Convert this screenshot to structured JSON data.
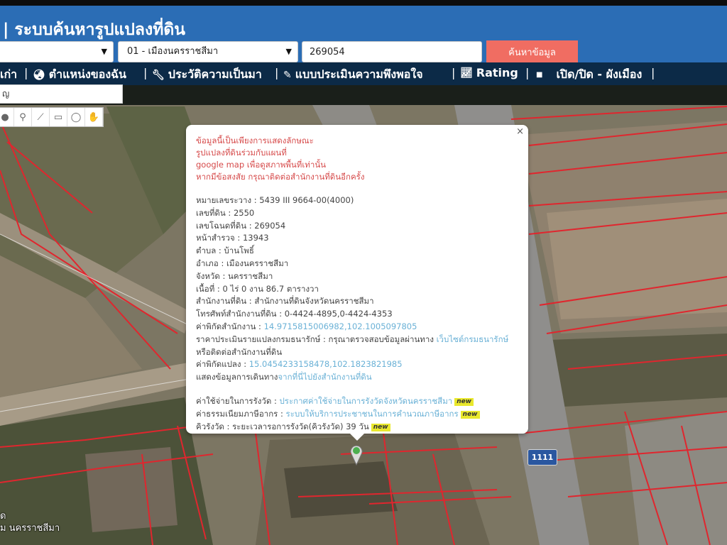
{
  "header": {
    "title": "| ระบบค้นหารูปแปลงที่ดิน",
    "province_select": "",
    "district_select": "01 - เมืองนครราชสีมา",
    "parcel_input": "269054",
    "search_button": "ค้นหาข้อมูล"
  },
  "nav": {
    "items": [
      "เก่า",
      "ตำแหน่งของฉัน",
      "ประวัติความเป็นมา",
      "แบบประเมินความพึงพอใจ",
      "Rating",
      "เปิด/ปิด - ผังเมือง"
    ],
    "separator": "|"
  },
  "map": {
    "search_box": "ญ",
    "road_sign": "1111",
    "corner_label_1": "ด",
    "corner_label_2": "ม นครราชสีมา"
  },
  "popup": {
    "close": "×",
    "warning": [
      "ข้อมูลนี้เป็นเพียงการแสดงลักษณะ",
      "รูปแปลงที่ดินร่วมกับแผนที่",
      "google map เพื่อดูสภาพพื้นที่เท่านั้น",
      "หากมีข้อสงสัย กรุณาติดต่อสำนักงานที่ดินอีกครั้ง"
    ],
    "fields": [
      {
        "label": "หมายเลขระวาง : ",
        "value": "5439 III 9664-00(4000)"
      },
      {
        "label": "เลขที่ดิน : ",
        "value": "2550"
      },
      {
        "label": "เลขโฉนดที่ดิน : ",
        "value": "269054"
      },
      {
        "label": "หน้าสำรวจ : ",
        "value": "13943"
      },
      {
        "label": "ตำบล : ",
        "value": "บ้านโพธิ์"
      },
      {
        "label": "อำเภอ : ",
        "value": "เมืองนครราชสีมา"
      },
      {
        "label": "จังหวัด : ",
        "value": "นครราชสีมา"
      },
      {
        "label": "เนื้อที่ : ",
        "value": "0 ไร่ 0 งาน 86.7 ตารางวา"
      },
      {
        "label": "สำนักงานที่ดิน : ",
        "value": "สำนักงานที่ดินจังหวัดนครราชสีมา"
      },
      {
        "label": "โทรศัพท์สำนักงานที่ดิน : ",
        "value": "0-4424-4895,0-4424-4353"
      }
    ],
    "office_coord_label": "ค่าพิกัดสำนักงาน : ",
    "office_coord": "14.9715815006982,102.1005097805",
    "price_label": "ราคาประเมินรายแปลงกรมธนารักษ์ : กรุณาตรวจสอบข้อมูลผ่านทาง ",
    "price_link": "เว็บไซต์กรมธนารักษ์",
    "price_line2": "หรือติดต่อสำนักงานที่ดิน",
    "parcel_coord_label": "ค่าพิกัดแปลง : ",
    "parcel_coord": "15.0454233158478,102.1823821985",
    "route_label": "แสดงข้อมูลการเดินทาง",
    "route_link": "จากที่นี่ไปยังสำนักงานที่ดิน",
    "extra": [
      {
        "label": "ค่าใช้จ่ายในการรังวัด : ",
        "value": "ประกาศค่าใช้จ่ายในการรังวัดจังหวัดนครราชสีมา",
        "link": true,
        "badge": "new"
      },
      {
        "label": "ค่าธรรมเนียมภาษีอากร : ",
        "value": "ระบบให้บริการประชาชนในการคำนวณภาษีอากร",
        "link": true,
        "badge": "new"
      },
      {
        "label": "คิวรังวัด : ",
        "value": "ระยะเวลารอการรังวัด(คิวรังวัด) 39 วัน",
        "link": false,
        "badge": "new"
      }
    ]
  }
}
